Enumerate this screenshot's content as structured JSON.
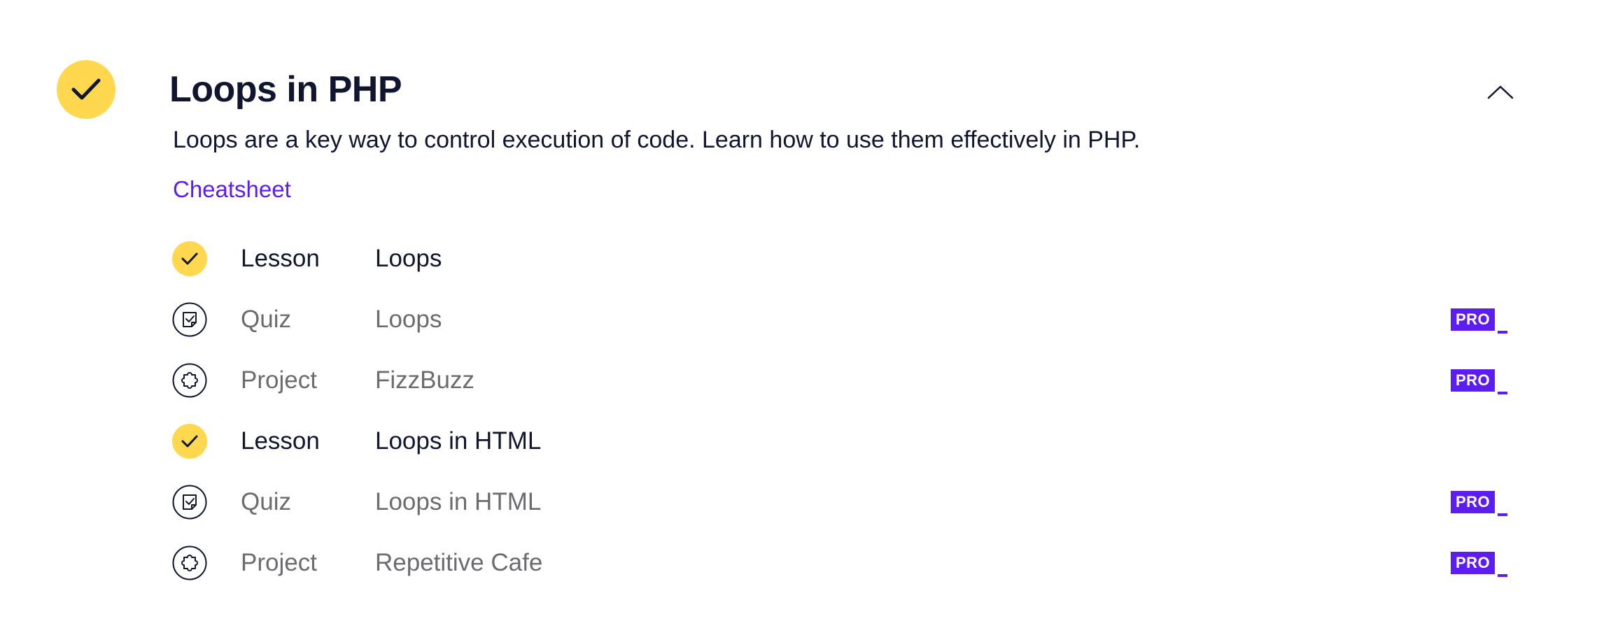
{
  "module": {
    "title": "Loops in PHP",
    "description": "Loops are a key way to control execution of code. Learn how to use them effectively in PHP.",
    "cheatsheet_label": "Cheatsheet",
    "status": "completed",
    "expanded": true
  },
  "items": [
    {
      "type": "Lesson",
      "name": "Loops",
      "status": "completed",
      "icon": "checkmark-icon",
      "pro": ""
    },
    {
      "type": "Quiz",
      "name": "Loops",
      "status": "locked",
      "icon": "quiz-icon",
      "pro": "PRO"
    },
    {
      "type": "Project",
      "name": "FizzBuzz",
      "status": "locked",
      "icon": "puzzle-icon",
      "pro": "PRO"
    },
    {
      "type": "Lesson",
      "name": "Loops in HTML",
      "status": "completed",
      "icon": "checkmark-icon",
      "pro": ""
    },
    {
      "type": "Quiz",
      "name": "Loops in HTML",
      "status": "locked",
      "icon": "quiz-icon",
      "pro": "PRO"
    },
    {
      "type": "Project",
      "name": "Repetitive Cafe",
      "status": "locked",
      "icon": "puzzle-icon",
      "pro": "PRO"
    }
  ],
  "colors": {
    "completed_yellow": "#ffd84f",
    "pro_purple": "#5d1df0",
    "link_purple": "#5d1df0",
    "text_dark": "#10162f",
    "text_muted": "#6b6b70"
  }
}
